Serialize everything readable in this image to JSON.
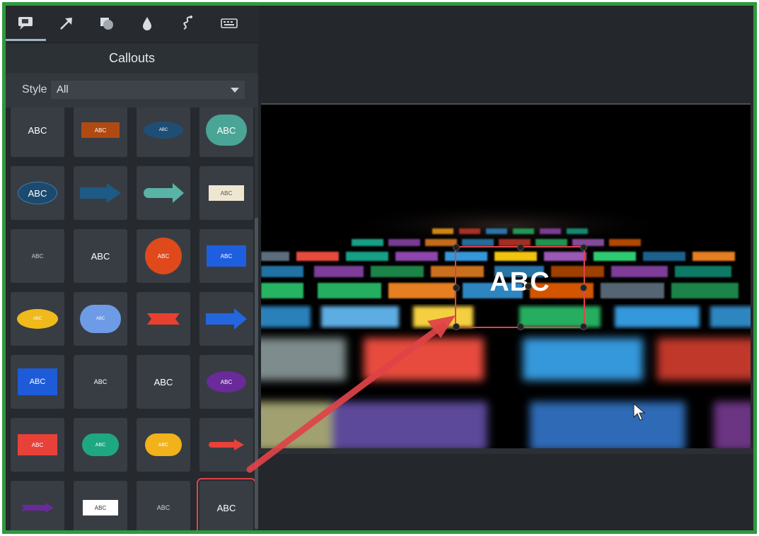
{
  "tabs": [
    {
      "name": "annotations-icon",
      "active": true
    },
    {
      "name": "arrow-icon",
      "active": false
    },
    {
      "name": "shapes-icon",
      "active": false
    },
    {
      "name": "blur-icon",
      "active": false
    },
    {
      "name": "sketch-motion-icon",
      "active": false
    },
    {
      "name": "keyboard-icon",
      "active": false
    }
  ],
  "panel": {
    "title": "Callouts",
    "style_label": "Style",
    "style_value": "All"
  },
  "callouts": {
    "label": "ABC",
    "rows": 7,
    "cols": 4,
    "selected_index": 27
  },
  "canvas": {
    "callout_text": "ABC"
  },
  "colors": {
    "border": "#2e9a3c",
    "highlight": "#e04347",
    "panel": "#2f343a"
  }
}
